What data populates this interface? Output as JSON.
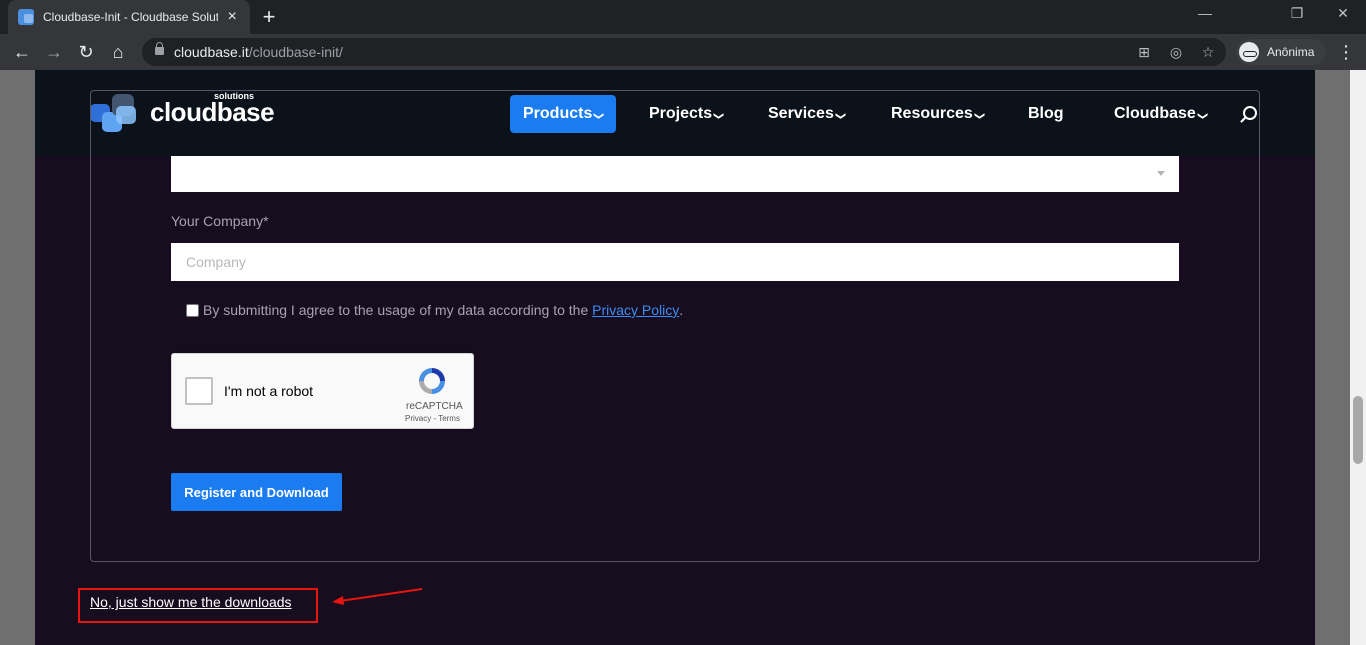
{
  "browser": {
    "tab_title": "Cloudbase-Init - Cloudbase Solutions",
    "tab_close": "×",
    "new_tab": "+",
    "url_host": "cloudbase.it",
    "url_path": "/cloudbase-init/",
    "profile_label": "Anônima",
    "window_minimize": "—",
    "window_restore": "❐",
    "window_close": "✕",
    "nav_back": "←",
    "nav_forward": "→",
    "nav_reload": "↻",
    "nav_home": "⌂",
    "omni_translate": "⊞",
    "omni_eye": "◎",
    "omni_star": "☆",
    "menu": "⋮"
  },
  "site": {
    "logo_text": "cloudbase",
    "logo_sub": "solutions",
    "nav": [
      {
        "label": "Products",
        "chevron": "❯"
      },
      {
        "label": "Projects",
        "chevron": "❯"
      },
      {
        "label": "Services",
        "chevron": "❯"
      },
      {
        "label": "Resources",
        "chevron": "❯"
      },
      {
        "label": "Blog"
      },
      {
        "label": "Cloudbase",
        "chevron": "❯"
      }
    ]
  },
  "form": {
    "company_label": "Your Company*",
    "company_placeholder": "Company",
    "consent_text": "By submitting I agree to the usage of my data according to the ",
    "consent_link": "Privacy Policy",
    "consent_end": ".",
    "recaptcha_label": "I'm not a robot",
    "recaptcha_brand": "reCAPTCHA",
    "recaptcha_terms": "Privacy - Terms",
    "submit_label": "Register and Download"
  },
  "downloads_link": "No, just show me the downloads",
  "colors": {
    "accent": "#1a7cf0",
    "page_bg": "#170d1e",
    "header_bg": "#0c121a",
    "annotation": "#e8140f"
  }
}
